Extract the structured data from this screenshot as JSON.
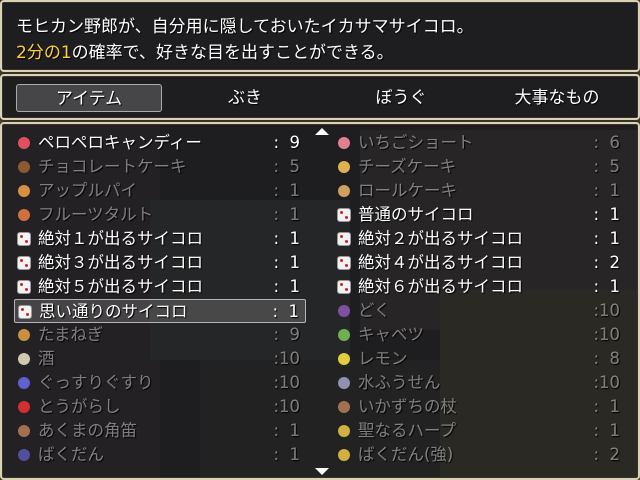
{
  "help": {
    "line1": "モヒカン野郎が、自分用に隠しておいたイカサマサイコロ。",
    "line2_highlight": "2分の1",
    "line2_rest": "の確率で、好きな目を出すことができる。"
  },
  "tabs": [
    {
      "label": "アイテム",
      "selected": true
    },
    {
      "label": "ぶき",
      "selected": false
    },
    {
      "label": "ぼうぐ",
      "selected": false
    },
    {
      "label": "大事なもの",
      "selected": false
    }
  ],
  "items_left": [
    {
      "name": "ペロペロキャンディー",
      "qty": ":  9",
      "icon": "candy-icon",
      "color": "#e05060",
      "dim": false
    },
    {
      "name": "チョコレートケーキ",
      "qty": ":  5",
      "icon": "chocolate-cake-icon",
      "color": "#8a5a30",
      "dim": true
    },
    {
      "name": "アップルパイ",
      "qty": ":  1",
      "icon": "apple-pie-icon",
      "color": "#d89040",
      "dim": true
    },
    {
      "name": "フルーツタルト",
      "qty": ":  1",
      "icon": "fruit-tart-icon",
      "color": "#d07040",
      "dim": true
    },
    {
      "name": "絶対１が出るサイコロ",
      "qty": ":  1",
      "icon": "die-icon",
      "color": "#ffffff",
      "dim": false
    },
    {
      "name": "絶対３が出るサイコロ",
      "qty": ":  1",
      "icon": "die-icon",
      "color": "#ffffff",
      "dim": false
    },
    {
      "name": "絶対５が出るサイコロ",
      "qty": ":  1",
      "icon": "die-icon",
      "color": "#ffffff",
      "dim": false
    },
    {
      "name": "思い通りのサイコロ",
      "qty": ":  1",
      "icon": "die-icon",
      "color": "#ffffff",
      "dim": false,
      "cursor": true
    },
    {
      "name": "たまねぎ",
      "qty": ":  9",
      "icon": "onion-icon",
      "color": "#c89040",
      "dim": true
    },
    {
      "name": "酒",
      "qty": ":10",
      "icon": "sake-icon",
      "color": "#d0c8b0",
      "dim": true
    },
    {
      "name": "ぐっすりぐすり",
      "qty": ":10",
      "icon": "potion-icon",
      "color": "#6060d0",
      "dim": true
    },
    {
      "name": "とうがらし",
      "qty": ":10",
      "icon": "chili-icon",
      "color": "#d03030",
      "dim": true
    },
    {
      "name": "あくまの角笛",
      "qty": ":  1",
      "icon": "horn-icon",
      "color": "#a07050",
      "dim": true
    },
    {
      "name": "ばくだん",
      "qty": ":  1",
      "icon": "bomb-icon",
      "color": "#5050a0",
      "dim": true
    }
  ],
  "items_right": [
    {
      "name": "いちごショート",
      "qty": ":  6",
      "icon": "strawberry-cake-icon",
      "color": "#e08090",
      "dim": true
    },
    {
      "name": "チーズケーキ",
      "qty": ":  5",
      "icon": "cheesecake-icon",
      "color": "#e0b050",
      "dim": true
    },
    {
      "name": "ロールケーキ",
      "qty": ":  1",
      "icon": "roll-cake-icon",
      "color": "#d0a060",
      "dim": true
    },
    {
      "name": "普通のサイコロ",
      "qty": ":  1",
      "icon": "die-icon",
      "color": "#ffffff",
      "dim": false
    },
    {
      "name": "絶対２が出るサイコロ",
      "qty": ":  1",
      "icon": "die-icon",
      "color": "#ffffff",
      "dim": false
    },
    {
      "name": "絶対４が出るサイコロ",
      "qty": ":  2",
      "icon": "die-icon",
      "color": "#ffffff",
      "dim": false
    },
    {
      "name": "絶対６が出るサイコロ",
      "qty": ":  1",
      "icon": "die-icon",
      "color": "#ffffff",
      "dim": false
    },
    {
      "name": "どく",
      "qty": ":10",
      "icon": "poison-icon",
      "color": "#8050a0",
      "dim": true
    },
    {
      "name": "キャベツ",
      "qty": ":10",
      "icon": "cabbage-icon",
      "color": "#70b050",
      "dim": true
    },
    {
      "name": "レモン",
      "qty": ":  8",
      "icon": "lemon-icon",
      "color": "#e0d040",
      "dim": true
    },
    {
      "name": "水ふうせん",
      "qty": ":10",
      "icon": "water-balloon-icon",
      "color": "#9090b0",
      "dim": true
    },
    {
      "name": "いかずちの杖",
      "qty": ":  1",
      "icon": "staff-icon",
      "color": "#a07050",
      "dim": true
    },
    {
      "name": "聖なるハープ",
      "qty": ":  1",
      "icon": "harp-icon",
      "color": "#d0b040",
      "dim": true
    },
    {
      "name": "ばくだん(強)",
      "qty": ":  2",
      "icon": "bomb-icon",
      "color": "#d0b040",
      "dim": true
    }
  ]
}
